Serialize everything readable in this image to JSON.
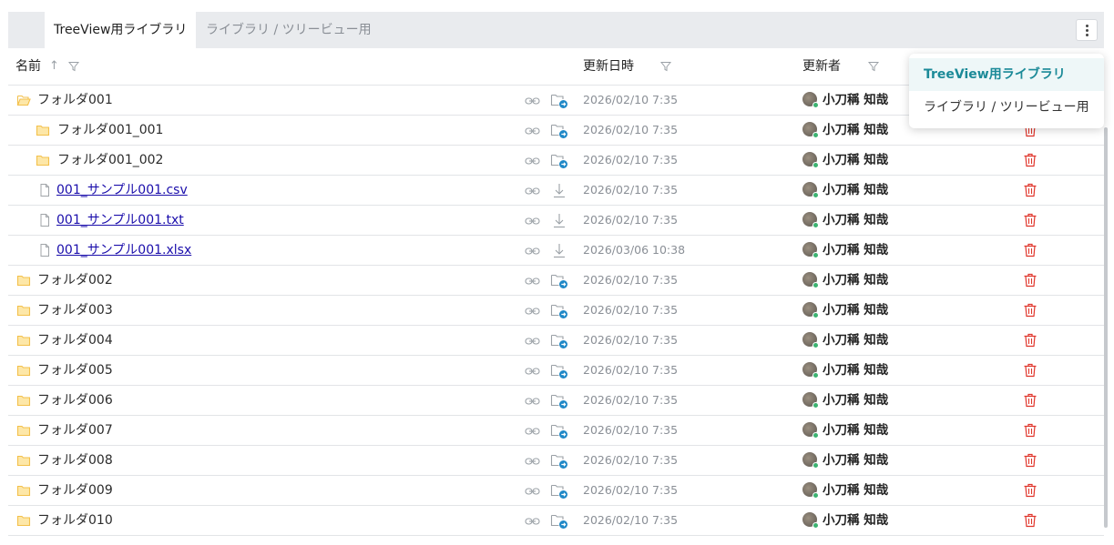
{
  "tabs": {
    "active": "TreeView用ライブラリ",
    "inactive": "ライブラリ / ツリービュー用"
  },
  "menu_icon": "kebab-vertical-icon",
  "columns": {
    "name": "名前",
    "modified": "更新日時",
    "modified_by": "更新者",
    "sort_icon": "↑"
  },
  "rows": [
    {
      "type": "folder-open",
      "indent": 0,
      "name": "フォルダ001",
      "date": "2026/02/10 7:35",
      "user": "小刀稱 知哉"
    },
    {
      "type": "folder",
      "indent": 1,
      "name": "フォルダ001_001",
      "date": "2026/02/10 7:35",
      "user": "小刀稱 知哉"
    },
    {
      "type": "folder",
      "indent": 1,
      "name": "フォルダ001_002",
      "date": "2026/02/10 7:35",
      "user": "小刀稱 知哉"
    },
    {
      "type": "file",
      "indent": 1,
      "name": "001_サンプル001.csv",
      "date": "2026/02/10 7:35",
      "user": "小刀稱 知哉"
    },
    {
      "type": "file",
      "indent": 1,
      "name": "001_サンプル001.txt",
      "date": "2026/02/10 7:35",
      "user": "小刀稱 知哉"
    },
    {
      "type": "file",
      "indent": 1,
      "name": "001_サンプル001.xlsx",
      "date": "2026/03/06 10:38",
      "user": "小刀稱 知哉"
    },
    {
      "type": "folder",
      "indent": 0,
      "name": "フォルダ002",
      "date": "2026/02/10 7:35",
      "user": "小刀稱 知哉"
    },
    {
      "type": "folder",
      "indent": 0,
      "name": "フォルダ003",
      "date": "2026/02/10 7:35",
      "user": "小刀稱 知哉"
    },
    {
      "type": "folder",
      "indent": 0,
      "name": "フォルダ004",
      "date": "2026/02/10 7:35",
      "user": "小刀稱 知哉"
    },
    {
      "type": "folder",
      "indent": 0,
      "name": "フォルダ005",
      "date": "2026/02/10 7:35",
      "user": "小刀稱 知哉"
    },
    {
      "type": "folder",
      "indent": 0,
      "name": "フォルダ006",
      "date": "2026/02/10 7:35",
      "user": "小刀稱 知哉"
    },
    {
      "type": "folder",
      "indent": 0,
      "name": "フォルダ007",
      "date": "2026/02/10 7:35",
      "user": "小刀稱 知哉"
    },
    {
      "type": "folder",
      "indent": 0,
      "name": "フォルダ008",
      "date": "2026/02/10 7:35",
      "user": "小刀稱 知哉"
    },
    {
      "type": "folder",
      "indent": 0,
      "name": "フォルダ009",
      "date": "2026/02/10 7:35",
      "user": "小刀稱 知哉"
    },
    {
      "type": "folder",
      "indent": 0,
      "name": "フォルダ010",
      "date": "2026/02/10 7:35",
      "user": "小刀稱 知哉"
    }
  ],
  "dropdown": {
    "items": [
      {
        "label": "TreeView用ライブラリ",
        "selected": true
      },
      {
        "label": "ライブラリ / ツリービュー用",
        "selected": false
      }
    ]
  },
  "colors": {
    "folder": "#f3c04b",
    "link": "#1a0dab",
    "delete": "#e0352b",
    "move_badge": "#1e88c7",
    "accent": "#1b8a98"
  }
}
